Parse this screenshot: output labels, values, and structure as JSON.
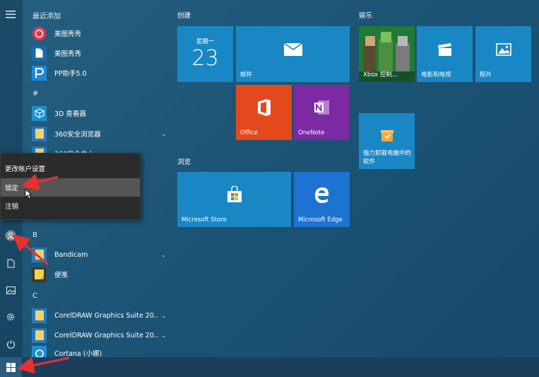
{
  "rail": {
    "icons": [
      "hamburger-menu-icon",
      "user-avatar-icon",
      "document-icon",
      "pictures-icon",
      "settings-gear-icon",
      "power-icon"
    ]
  },
  "app_list": {
    "recent_header": "最近添加",
    "recent_apps": [
      {
        "label": "美图秀秀",
        "icon": "meitu-icon",
        "color": "#e4334f"
      },
      {
        "label": "美图秀秀",
        "icon": "document-icon",
        "color": "#ffffff"
      },
      {
        "label": "PP助手5.0",
        "icon": "pp-assistant-icon",
        "color": "#1e88d8"
      }
    ],
    "hash_letter": "#",
    "hash_apps": [
      {
        "label": "3D 查看器",
        "icon": "cube-3d-icon",
        "color": "#1d8fd1"
      },
      {
        "label": "360安全浏览器",
        "icon": "folder-icon",
        "color": "#f3d36d"
      },
      {
        "label": "360安全中心",
        "icon": "folder-icon",
        "color": "#f3d36d"
      }
    ],
    "b_letter": "B",
    "b_apps": [
      {
        "label": "Bandicam",
        "icon": "folder-icon",
        "color": "#f3d36d"
      },
      {
        "label": "便笺",
        "icon": "sticky-note-icon",
        "color": "#f6d44a"
      }
    ],
    "c_letter": "C",
    "c_apps": [
      {
        "label": "CorelDRAW Graphics Suite 20...",
        "icon": "folder-icon",
        "color": "#f3d36d"
      },
      {
        "label": "CorelDRAW Graphics Suite 20...",
        "icon": "folder-icon",
        "color": "#f3d36d"
      },
      {
        "label": "Cortana (小娜)",
        "icon": "cortana-icon",
        "color": "#1d8fd1"
      }
    ]
  },
  "context_menu": {
    "items": [
      "更改帐户设置",
      "锁定",
      "注销"
    ]
  },
  "sections": {
    "create": "创建",
    "browse": "浏览",
    "entertainment": "娱乐"
  },
  "tiles": {
    "calendar": {
      "weekday": "星期一",
      "day": "23"
    },
    "mail": "邮件",
    "office": "Office",
    "onenote": "OneNote",
    "store": "Microsoft Store",
    "edge": "Microsoft Edge",
    "xbox": "Xbox 控制...",
    "movies": "电影和电视",
    "photos": "照片",
    "uninstaller": "强力卸载电脑中的软件"
  },
  "colors": {
    "tile_blue": "#1a87c5",
    "office_orange": "#e3491c",
    "onenote_purple": "#7c2aa1",
    "edge_blue": "#1d73d1",
    "menu_bg": "#2b2b2b",
    "menu_highlight": "#555555",
    "arrow_red": "#e8302e"
  }
}
